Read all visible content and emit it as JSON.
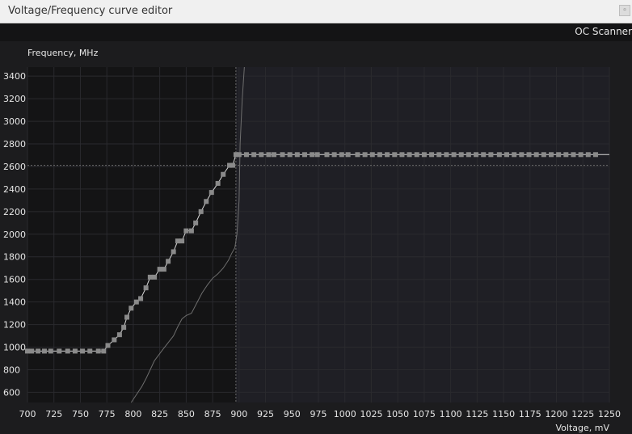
{
  "window": {
    "title": "Voltage/Frequency curve editor",
    "close_glyph": "▫"
  },
  "toolbar": {
    "oc_scanner_label": "OC Scanner"
  },
  "colors": {
    "plot_left_bg": "#141415",
    "plot_right_bg": "#1f1f25",
    "grid": "#2a2a2e",
    "curve": "#d8d8d8",
    "point": "#8a8a8a",
    "reference_curve": "#6e6e6e",
    "guide": "#6a6a6a",
    "tick_text": "#e6e6e6"
  },
  "chart_data": {
    "type": "line",
    "title": "",
    "ylabel": "Frequency, MHz",
    "xlabel": "Voltage, mV",
    "xlim": [
      700,
      1250
    ],
    "ylim": [
      510,
      3480
    ],
    "xticks": [
      700,
      725,
      750,
      775,
      800,
      825,
      850,
      875,
      900,
      925,
      950,
      975,
      1000,
      1025,
      1050,
      1075,
      1100,
      1125,
      1150,
      1175,
      1200,
      1225,
      1250
    ],
    "yticks": [
      600,
      800,
      1000,
      1200,
      1400,
      1600,
      1800,
      2000,
      2200,
      2400,
      2600,
      2800,
      3000,
      3200,
      3400
    ],
    "grid": true,
    "selected_voltage": 897,
    "locked_frequency": 2610,
    "curve": {
      "x": [
        700,
        704,
        710,
        716,
        722,
        730,
        738,
        745,
        752,
        759,
        767,
        772,
        776,
        782,
        787,
        791,
        794,
        798,
        803,
        807,
        812,
        816,
        820,
        825,
        829,
        833,
        838,
        842,
        846,
        850,
        855,
        859,
        864,
        869,
        874,
        880,
        885,
        891,
        894,
        897,
        900,
        1250
      ],
      "y": [
        965,
        965,
        965,
        965,
        965,
        965,
        965,
        965,
        965,
        965,
        965,
        965,
        1015,
        1065,
        1110,
        1175,
        1265,
        1345,
        1400,
        1430,
        1525,
        1620,
        1620,
        1690,
        1690,
        1760,
        1845,
        1940,
        1940,
        2030,
        2030,
        2100,
        2200,
        2290,
        2370,
        2450,
        2530,
        2610,
        2610,
        2705,
        2705,
        2705
      ]
    },
    "points": {
      "x": [
        700,
        704,
        710,
        716,
        722,
        730,
        738,
        745,
        752,
        759,
        767,
        772,
        776,
        782,
        787,
        791,
        794,
        798,
        803,
        807,
        812,
        816,
        820,
        825,
        829,
        833,
        838,
        842,
        846,
        850,
        855,
        859,
        864,
        869,
        874,
        880,
        885,
        891,
        894,
        897,
        900,
        907,
        914,
        921,
        928,
        933,
        941,
        948,
        955,
        962,
        969,
        974,
        983,
        990,
        997,
        1003,
        1012,
        1019,
        1026,
        1033,
        1040,
        1047,
        1054,
        1061,
        1068,
        1075,
        1082,
        1089,
        1096,
        1103,
        1110,
        1117,
        1124,
        1131,
        1138,
        1146,
        1153,
        1160,
        1167,
        1174,
        1181,
        1188,
        1195,
        1202,
        1209,
        1216,
        1223,
        1230,
        1237
      ],
      "y": [
        965,
        965,
        965,
        965,
        965,
        965,
        965,
        965,
        965,
        965,
        965,
        965,
        1015,
        1065,
        1110,
        1175,
        1265,
        1345,
        1400,
        1430,
        1525,
        1620,
        1620,
        1690,
        1690,
        1760,
        1845,
        1940,
        1940,
        2030,
        2030,
        2100,
        2200,
        2290,
        2370,
        2450,
        2530,
        2610,
        2610,
        2705,
        2705,
        2705,
        2705,
        2705,
        2705,
        2705,
        2705,
        2705,
        2705,
        2705,
        2705,
        2705,
        2705,
        2705,
        2705,
        2705,
        2705,
        2705,
        2705,
        2705,
        2705,
        2705,
        2705,
        2705,
        2705,
        2705,
        2705,
        2705,
        2705,
        2705,
        2705,
        2705,
        2705,
        2705,
        2705,
        2705,
        2705,
        2705,
        2705,
        2705,
        2705,
        2705,
        2705,
        2705,
        2705,
        2705,
        2705,
        2705,
        2705
      ]
    },
    "reference_curve": {
      "x": [
        798,
        803,
        808,
        812,
        816,
        820,
        824,
        828,
        833,
        838,
        842,
        846,
        850,
        855,
        860,
        865,
        870,
        875,
        880,
        885,
        890,
        893,
        896,
        898,
        900,
        901,
        903,
        905
      ],
      "y": [
        510,
        580,
        650,
        720,
        800,
        880,
        930,
        980,
        1040,
        1100,
        1180,
        1250,
        1280,
        1300,
        1390,
        1480,
        1550,
        1610,
        1650,
        1700,
        1770,
        1830,
        1880,
        2000,
        2300,
        2800,
        3200,
        3480
      ]
    }
  }
}
